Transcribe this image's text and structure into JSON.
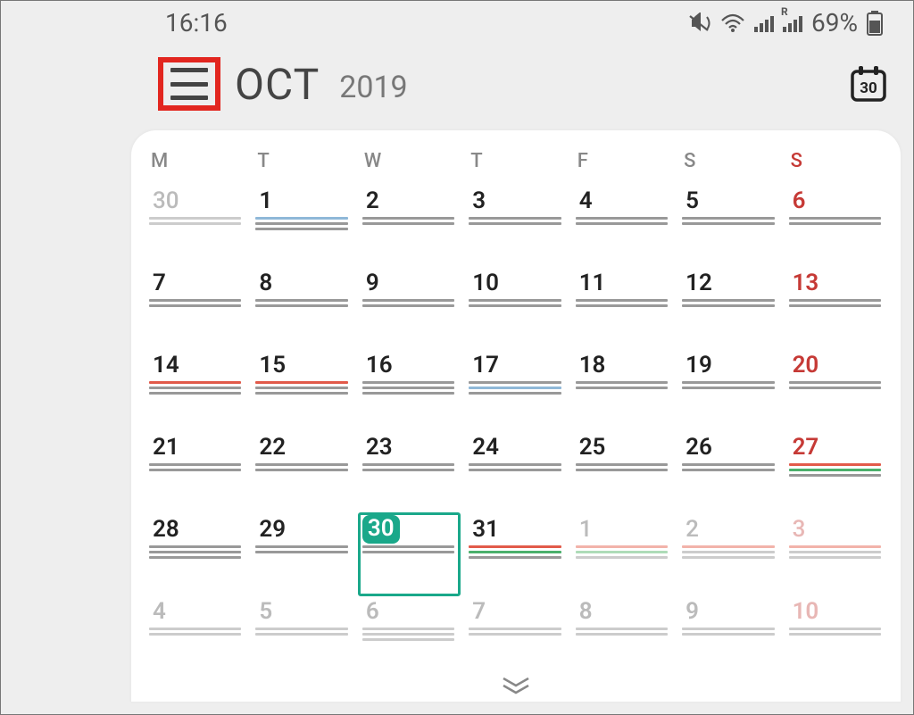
{
  "status": {
    "time": "16:16",
    "battery_pct": "69%",
    "roaming": "R"
  },
  "header": {
    "month": "OCT",
    "year": "2019",
    "today_badge": "30"
  },
  "dow": [
    "M",
    "T",
    "W",
    "T",
    "F",
    "S",
    "S"
  ],
  "weeks": [
    [
      {
        "n": "30",
        "other": true,
        "lines": [
          "lgray",
          "lgray"
        ]
      },
      {
        "n": "1",
        "lines": [
          "blue",
          "gray",
          "gray"
        ]
      },
      {
        "n": "2",
        "lines": [
          "gray",
          "gray"
        ]
      },
      {
        "n": "3",
        "lines": [
          "gray",
          "gray"
        ]
      },
      {
        "n": "4",
        "lines": [
          "gray",
          "gray"
        ]
      },
      {
        "n": "5",
        "lines": [
          "gray",
          "gray"
        ]
      },
      {
        "n": "6",
        "sun": true,
        "lines": [
          "gray",
          "gray"
        ]
      }
    ],
    [
      {
        "n": "7",
        "lines": [
          "gray",
          "gray"
        ]
      },
      {
        "n": "8",
        "lines": [
          "gray",
          "gray"
        ]
      },
      {
        "n": "9",
        "lines": [
          "gray",
          "gray"
        ]
      },
      {
        "n": "10",
        "lines": [
          "gray",
          "gray"
        ]
      },
      {
        "n": "11",
        "lines": [
          "gray",
          "gray"
        ]
      },
      {
        "n": "12",
        "lines": [
          "gray",
          "gray"
        ]
      },
      {
        "n": "13",
        "sun": true,
        "lines": [
          "gray",
          "gray"
        ]
      }
    ],
    [
      {
        "n": "14",
        "lines": [
          "red",
          "gray",
          "gray"
        ]
      },
      {
        "n": "15",
        "lines": [
          "red",
          "gray",
          "gray"
        ]
      },
      {
        "n": "16",
        "lines": [
          "gray",
          "gray",
          "gray"
        ]
      },
      {
        "n": "17",
        "lines": [
          "gray",
          "blue",
          "gray"
        ]
      },
      {
        "n": "18",
        "lines": [
          "gray",
          "gray"
        ]
      },
      {
        "n": "19",
        "lines": [
          "gray",
          "gray"
        ]
      },
      {
        "n": "20",
        "sun": true,
        "lines": [
          "gray",
          "gray"
        ]
      }
    ],
    [
      {
        "n": "21",
        "lines": [
          "gray",
          "gray"
        ]
      },
      {
        "n": "22",
        "lines": [
          "gray",
          "gray"
        ]
      },
      {
        "n": "23",
        "lines": [
          "gray",
          "gray"
        ]
      },
      {
        "n": "24",
        "lines": [
          "gray",
          "gray"
        ]
      },
      {
        "n": "25",
        "lines": [
          "gray",
          "gray"
        ]
      },
      {
        "n": "26",
        "lines": [
          "gray",
          "gray"
        ]
      },
      {
        "n": "27",
        "sun": true,
        "lines": [
          "red",
          "green",
          "gray"
        ]
      }
    ],
    [
      {
        "n": "28",
        "lines": [
          "gray",
          "gray",
          "gray"
        ]
      },
      {
        "n": "29",
        "lines": [
          "gray",
          "gray"
        ]
      },
      {
        "n": "30",
        "today": true,
        "lines": [
          "gray",
          "gray"
        ]
      },
      {
        "n": "31",
        "lines": [
          "red",
          "green",
          "gray"
        ]
      },
      {
        "n": "1",
        "other": true,
        "lines": [
          "lred",
          "lgreen",
          "lgray"
        ]
      },
      {
        "n": "2",
        "other": true,
        "lines": [
          "lred",
          "lgray",
          "lgray"
        ]
      },
      {
        "n": "3",
        "other": true,
        "sun": true,
        "lines": [
          "lred",
          "lgray",
          "lgray"
        ]
      }
    ],
    [
      {
        "n": "4",
        "fade": true,
        "lines": [
          "lgray",
          "lgray"
        ]
      },
      {
        "n": "5",
        "fade": true,
        "lines": [
          "lgray",
          "lgray"
        ]
      },
      {
        "n": "6",
        "fade": true,
        "lines": [
          "lgray",
          "lgray",
          "lgray"
        ]
      },
      {
        "n": "7",
        "fade": true,
        "lines": [
          "lgray",
          "lgray"
        ]
      },
      {
        "n": "8",
        "fade": true,
        "lines": [
          "lgray",
          "lgray"
        ]
      },
      {
        "n": "9",
        "fade": true,
        "lines": [
          "lgray",
          "lgray"
        ]
      },
      {
        "n": "10",
        "fade": true,
        "sun": true,
        "lines": [
          "lgray",
          "lgray"
        ]
      }
    ]
  ]
}
